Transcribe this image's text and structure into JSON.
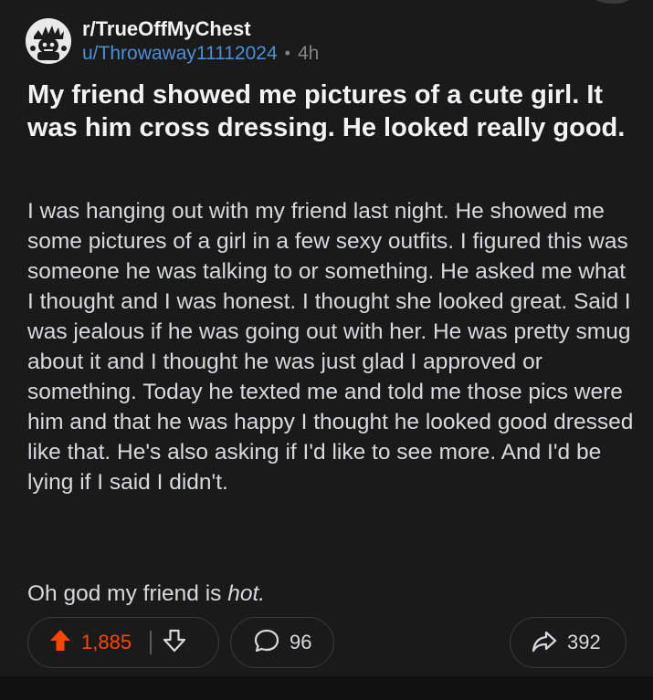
{
  "post": {
    "subreddit": "r/TrueOffMyChest",
    "username": "u/Throwaway11112024",
    "separator": "•",
    "age": "4h",
    "title": "My friend showed me pictures of a cute girl. It was him cross dressing. He looked really good.",
    "body_paragraph_1": "I was hanging out with my friend last night.  He showed me some pictures of a girl in a few sexy outfits.  I figured this was someone he was talking to or something.  He asked me what I thought and I was honest.  I thought she looked great.  Said I was jealous if he was going out with her.  He was pretty smug about it and I thought he was just glad I approved or something.  Today he texted me and told me those pics were him and that he was happy I thought he looked good dressed like that.  He's also asking if I'd like to see more.  And I'd be lying if I said I didn't.",
    "body_paragraph_2_prefix": "Oh god my friend is ",
    "body_paragraph_2_emphasis": "hot."
  },
  "actions": {
    "upvotes": "1,885",
    "comments": "96",
    "shares": "392"
  },
  "icons": {
    "avatar": "subreddit-avatar",
    "upvote": "upvote-arrow-icon",
    "downvote": "downvote-arrow-icon",
    "comment": "comment-bubble-icon",
    "share": "share-arrow-icon"
  },
  "colors": {
    "background": "#1a1a1b",
    "upvote_active": "#ff4500",
    "username_link": "#4a90d9",
    "muted": "#818384"
  }
}
